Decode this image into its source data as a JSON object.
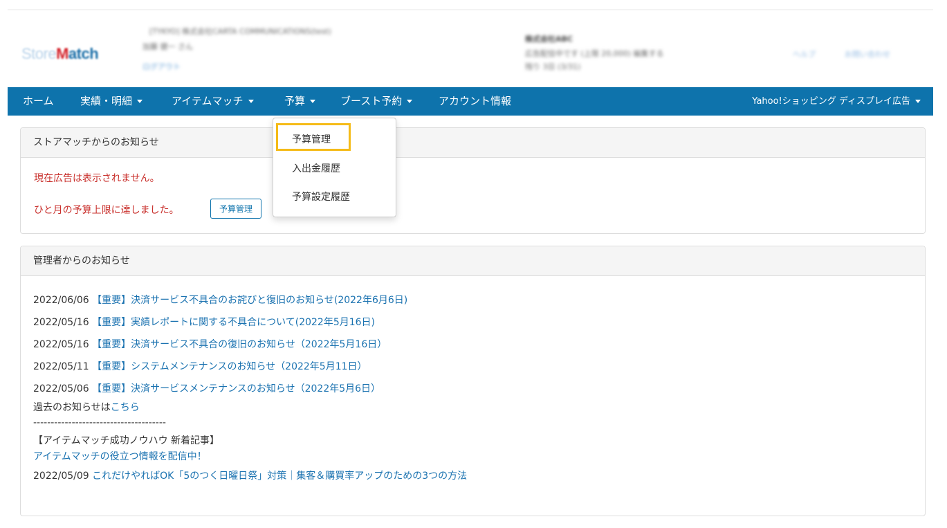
{
  "header": {
    "logo_part1": "Store",
    "logo_part2": "Match",
    "blurred_company": "[TYKYO] 株式会社CARTA COMMUNICATIONS(test)",
    "blurred_user": "加藤 健一 さん",
    "blurred_logout": "ログアウト",
    "blurred_store_title": "株式会社ABC",
    "blurred_store_line1": "広告配信中です (上限 20,000) 編集する",
    "blurred_store_line2": "残り 3日 (3/31)",
    "blurred_help": "ヘルプ",
    "blurred_contact": "お問い合わせ"
  },
  "nav": {
    "home": "ホーム",
    "results": "実績・明細",
    "itemmatch": "アイテムマッチ",
    "budget": "予算",
    "boost": "ブースト予約",
    "account": "アカウント情報",
    "right": "Yahoo!ショッピング ディスプレイ広告"
  },
  "dropdown": {
    "items": [
      "予算管理",
      "入出金履歴",
      "予算設定履歴"
    ],
    "highlighted": "予算管理"
  },
  "store_notice": {
    "title": "ストアマッチからのお知らせ",
    "alert1": "現在広告は表示されません。",
    "alert2": "ひと月の予算上限に達しました。",
    "button": "予算管理"
  },
  "admin_notice": {
    "title": "管理者からのお知らせ",
    "news": [
      {
        "date": "2022/06/06",
        "text": "【重要】決済サービス不具合のお詫びと復旧のお知らせ(2022年6月6日)"
      },
      {
        "date": "2022/05/16",
        "text": "【重要】実績レポートに関する不具合について(2022年5月16日)"
      },
      {
        "date": "2022/05/16",
        "text": "【重要】決済サービス不具合の復旧のお知らせ（2022年5月16日）"
      },
      {
        "date": "2022/05/11",
        "text": "【重要】システムメンテナンスのお知らせ（2022年5月11日）"
      },
      {
        "date": "2022/05/06",
        "text": "【重要】決済サービスメンテナンスのお知らせ（2022年5月6日）"
      }
    ],
    "past_prefix": "過去のお知らせは",
    "past_link": "こちら",
    "divider": "--------------------------------------",
    "knowhow_title": "【アイテムマッチ成功ノウハウ 新着記事】",
    "knowhow_link": "アイテムマッチの役立つ情報を配信中！",
    "article_date": "2022/05/09",
    "article_text": "これだけやればOK「5のつく日曜日祭」対策｜集客＆購買率アップのための3つの方法"
  }
}
